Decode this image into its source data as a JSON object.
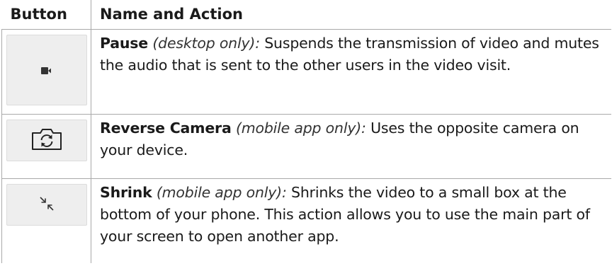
{
  "header": {
    "col_button": "Button",
    "col_name_action": "Name and Action"
  },
  "rows": [
    {
      "icon": "video-camera-icon",
      "name": "Pause",
      "qualifier": "(desktop only):",
      "description": "Suspends the transmission of video and mutes the audio that is sent to the other users in the video visit."
    },
    {
      "icon": "camera-flip-icon",
      "name": "Reverse Camera",
      "qualifier": "(mobile app only):",
      "description": "Uses the opposite camera on your device."
    },
    {
      "icon": "shrink-arrows-icon",
      "name": "Shrink",
      "qualifier": "(mobile app only):",
      "description": "Shrinks the video to a small box at the bottom of your phone. This action allows you to use the main part of your screen to open another app."
    }
  ],
  "colors": {
    "border": "#a9a9a9",
    "button_bg": "#eeeeee",
    "icon": "#333333"
  }
}
